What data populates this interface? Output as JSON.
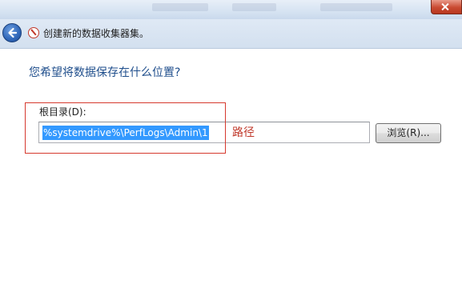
{
  "window": {
    "title": "创建新的数据收集器集。"
  },
  "nav": {
    "back_icon": "back-arrow-icon",
    "wizard_icon": "data-collector-set-icon"
  },
  "page": {
    "question": "您希望将数据保存在什么位置?",
    "root_dir_label": "根目录(D):",
    "root_dir_value": "%systemdrive%\\PerfLogs\\Admin\\1",
    "browse_label": "浏览(R)...",
    "annotation": "路径"
  },
  "colors": {
    "question_text": "#1f4e8c",
    "annotation": "#d6392e",
    "selection": "#3399ff"
  }
}
